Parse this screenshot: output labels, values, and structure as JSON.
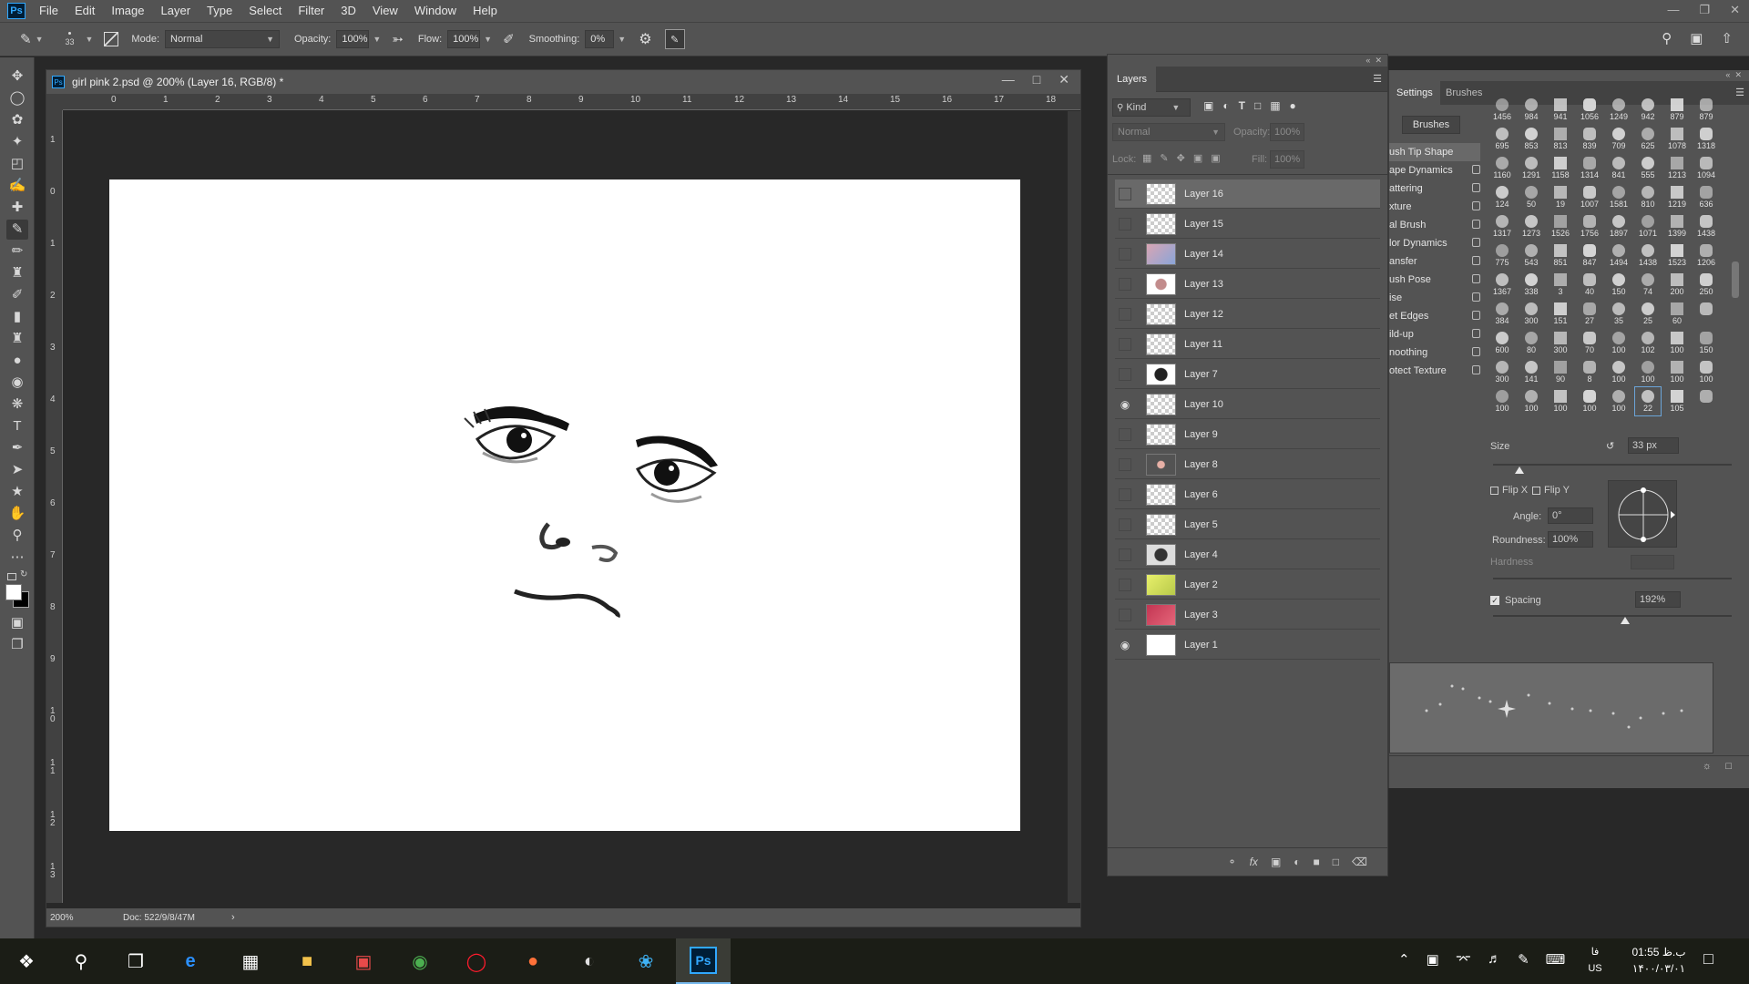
{
  "menubar": {
    "logo": "Ps",
    "items": [
      "File",
      "Edit",
      "Image",
      "Layer",
      "Type",
      "Select",
      "Filter",
      "3D",
      "View",
      "Window",
      "Help"
    ]
  },
  "options": {
    "brush_size": "33",
    "mode_label": "Mode:",
    "mode_value": "Normal",
    "opacity_label": "Opacity:",
    "opacity_value": "100%",
    "flow_label": "Flow:",
    "flow_value": "100%",
    "smoothing_label": "Smoothing:",
    "smoothing_value": "0%"
  },
  "document": {
    "title": "girl pink 2.psd @ 200% (Layer 16, RGB/8) *",
    "zoom": "200%",
    "doc_info": "Doc: 522/9/8/47M",
    "ruler_top": [
      "0",
      "1",
      "2",
      "3",
      "4",
      "5",
      "6",
      "7",
      "8",
      "9",
      "10",
      "11",
      "12",
      "13",
      "14",
      "15",
      "16",
      "17",
      "18"
    ],
    "ruler_left": [
      "1",
      "0",
      "1",
      "2",
      "3",
      "4",
      "5",
      "6",
      "7",
      "8",
      "9",
      "10",
      "11",
      "12",
      "13"
    ]
  },
  "layers_panel": {
    "tab": "Layers",
    "filter_kind": "Kind",
    "blend_mode": "Normal",
    "opacity_label": "Opacity:",
    "opacity_value": "100%",
    "lock_label": "Lock:",
    "fill_label": "Fill:",
    "fill_value": "100%",
    "layers": [
      {
        "name": "Layer 16",
        "visible": false,
        "selected": true
      },
      {
        "name": "Layer 15",
        "visible": false,
        "selected": false
      },
      {
        "name": "Layer 14",
        "visible": false,
        "selected": false
      },
      {
        "name": "Layer 13",
        "visible": false,
        "selected": false
      },
      {
        "name": "Layer 12",
        "visible": false,
        "selected": false
      },
      {
        "name": "Layer 11",
        "visible": false,
        "selected": false
      },
      {
        "name": "Layer 7",
        "visible": false,
        "selected": false
      },
      {
        "name": "Layer 10",
        "visible": true,
        "selected": false
      },
      {
        "name": "Layer 9",
        "visible": false,
        "selected": false
      },
      {
        "name": "Layer 8",
        "visible": false,
        "selected": false
      },
      {
        "name": "Layer 6",
        "visible": false,
        "selected": false
      },
      {
        "name": "Layer 5",
        "visible": false,
        "selected": false
      },
      {
        "name": "Layer 4",
        "visible": false,
        "selected": false
      },
      {
        "name": "Layer 2",
        "visible": false,
        "selected": false
      },
      {
        "name": "Layer 3",
        "visible": false,
        "selected": false
      },
      {
        "name": "Layer 1",
        "visible": true,
        "selected": false
      }
    ]
  },
  "brush_settings": {
    "tab_settings": "Settings",
    "tab_brushes": "Brushes",
    "brushes_button": "Brushes",
    "options": [
      "ush Tip Shape",
      "ape Dynamics",
      "attering",
      "xture",
      "al Brush",
      "lor Dynamics",
      "ansfer",
      "ush Pose",
      "ise",
      "et Edges",
      "ild-up",
      "noothing",
      "otect Texture"
    ],
    "brush_sizes": [
      "1456",
      "984",
      "941",
      "1056",
      "1249",
      "942",
      "879",
      "879",
      "695",
      "853",
      "813",
      "839",
      "709",
      "625",
      "1078",
      "1318",
      "1160",
      "1291",
      "1158",
      "1314",
      "841",
      "555",
      "1213",
      "1094",
      "124",
      "50",
      "19",
      "1007",
      "1581",
      "810",
      "1219",
      "636",
      "1317",
      "1273",
      "1526",
      "1756",
      "1897",
      "1071",
      "1399",
      "1438",
      "775",
      "543",
      "851",
      "847",
      "1494",
      "1438",
      "1523",
      "1206",
      "1367",
      "338",
      "3",
      "40",
      "150",
      "74",
      "200",
      "250",
      "384",
      "300",
      "151",
      "27",
      "35",
      "25",
      "60",
      "",
      "600",
      "80",
      "300",
      "70",
      "100",
      "102",
      "100",
      "150",
      "300",
      "141",
      "90",
      "8",
      "100",
      "100",
      "100",
      "100",
      "100",
      "100",
      "100",
      "100",
      "100",
      "22",
      "105",
      ""
    ],
    "size_label": "Size",
    "size_value": "33 px",
    "flip_x": "Flip X",
    "flip_y": "Flip Y",
    "angle_label": "Angle:",
    "angle_value": "0°",
    "roundness_label": "Roundness:",
    "roundness_value": "100%",
    "hardness_label": "Hardness",
    "spacing_label": "Spacing",
    "spacing_value": "192%"
  },
  "taskbar": {
    "time": "01:55 ب.ظ",
    "date": "۱۴۰۰/۰۳/۰۱",
    "lang_top": "فا",
    "lang_bottom": "US"
  }
}
